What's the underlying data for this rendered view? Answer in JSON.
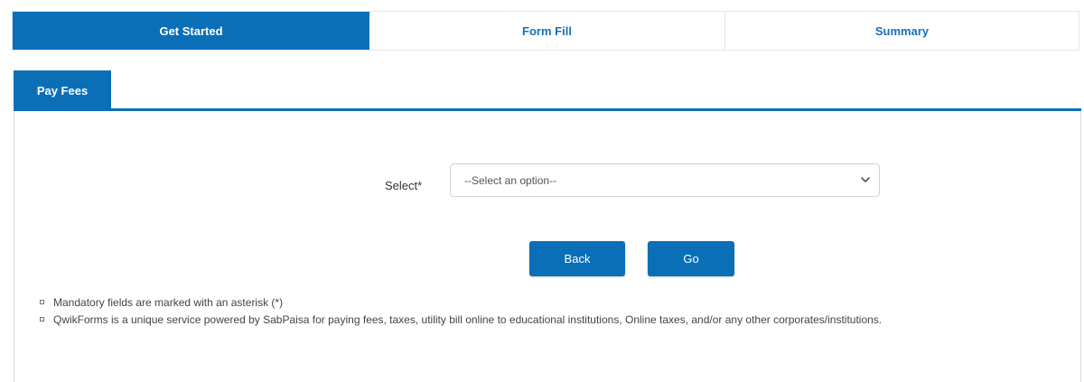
{
  "steps": [
    {
      "label": "Get Started",
      "active": true
    },
    {
      "label": "Form Fill",
      "active": false
    },
    {
      "label": "Summary",
      "active": false
    }
  ],
  "tab": {
    "label": "Pay Fees"
  },
  "form": {
    "select_label": "Select*",
    "select_value": "--Select an option--",
    "select_icon": "chevron-down-icon"
  },
  "buttons": {
    "back_label": "Back",
    "go_label": "Go"
  },
  "notes": [
    "Mandatory fields are marked with an asterisk (*)",
    "QwikForms is a unique service powered by SabPaisa for paying fees, taxes, utility bill online to educational institutions, Online taxes, and/or any other corporates/institutions."
  ],
  "colors": {
    "primary": "#0b6fb8",
    "step_inactive_text": "#1a6fb8",
    "border": "#d9dde1"
  }
}
